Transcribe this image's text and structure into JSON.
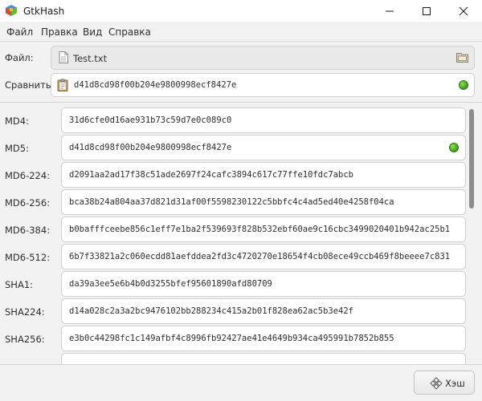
{
  "window": {
    "title": "GtkHash"
  },
  "menu": [
    "Файл",
    "Правка",
    "Вид",
    "Справка"
  ],
  "file": {
    "label": "Файл:",
    "name": "Test.txt"
  },
  "compare": {
    "label": "Сравнить:",
    "value": "d41d8cd98f00b204e9800998ecf8427e",
    "match": true
  },
  "hashes": [
    {
      "label": "MD4:",
      "value": "31d6cfe0d16ae931b73c59d7e0c089c0",
      "match": false
    },
    {
      "label": "MD5:",
      "value": "d41d8cd98f00b204e9800998ecf8427e",
      "match": true
    },
    {
      "label": "MD6-224:",
      "value": "d2091aa2ad17f38c51ade2697f24cafc3894c617c77ffe10fdc7abcb",
      "match": false
    },
    {
      "label": "MD6-256:",
      "value": "bca38b24a804aa37d821d31af00f5598230122c5bbfc4c4ad5ed40e4258f04ca",
      "match": false
    },
    {
      "label": "MD6-384:",
      "value": "b0bafffceebe856c1eff7e1ba2f539693f828b532ebf60ae9c16cbc3499020401b942ac25b1",
      "match": false
    },
    {
      "label": "MD6-512:",
      "value": "6b7f33821a2c060ecdd81aefddea2fd3c4720270e18654f4cb08ece49ccb469f8beeee7c831",
      "match": false
    },
    {
      "label": "SHA1:",
      "value": "da39a3ee5e6b4b0d3255bfef95601890afd80709",
      "match": false
    },
    {
      "label": "SHA224:",
      "value": "d14a028c2a3a2bc9476102bb288234c415a2b01f828ea62ac5b3e42f",
      "match": false
    },
    {
      "label": "SHA256:",
      "value": "e3b0c44298fc1c149afbf4c8996fb92427ae41e4649b934ca495991b7852b855",
      "match": false
    }
  ],
  "actions": {
    "hash_label": "Хэш"
  },
  "colors": {
    "match_indicator": "#3d9a16",
    "field_border": "#cfcfcf"
  }
}
